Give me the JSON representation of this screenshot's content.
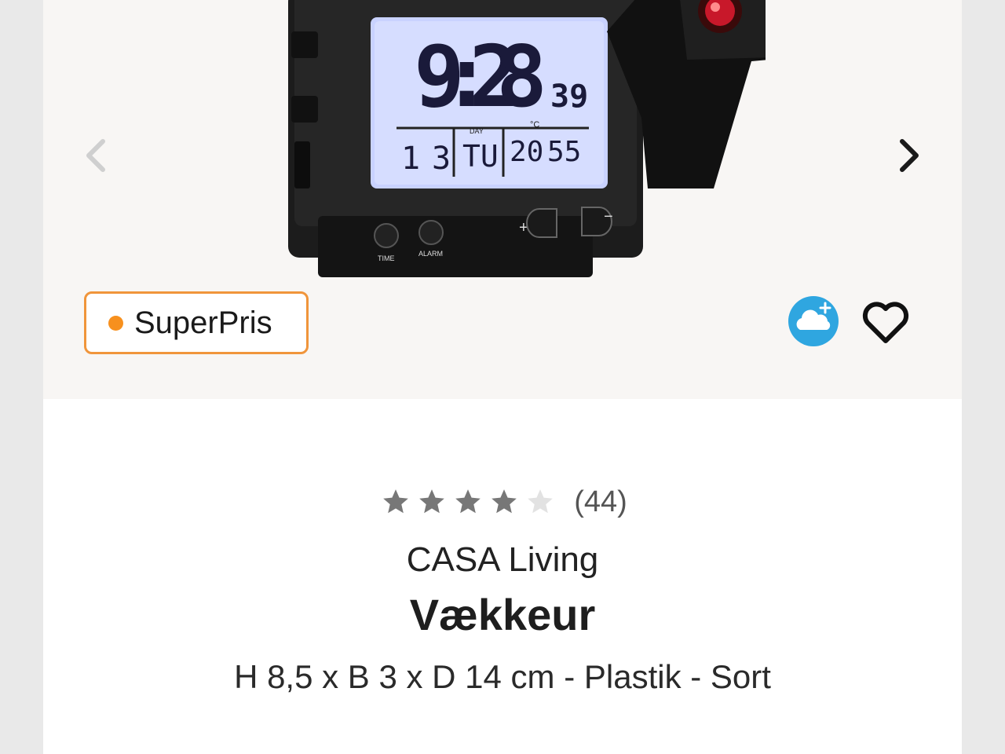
{
  "hero": {
    "badge_label": "SuperPris"
  },
  "product": {
    "rating": 4,
    "rating_max": 5,
    "review_count": "(44)",
    "brand": "CASA Living",
    "title": "Vækkeur",
    "description": "H 8,5 x B 3 x D 14 cm - Plastik - Sort"
  },
  "clock_display": {
    "time": "9:28",
    "seconds": "39",
    "date_day": "1",
    "date_month": "3",
    "weekday_label": "DAY",
    "weekday": "TU",
    "temperature": "20",
    "humidity": "55",
    "unit_label": "°C",
    "time_button": "TIME",
    "alarm_button": "ALARM",
    "plus": "+",
    "minus": "−"
  },
  "colors": {
    "badge_border": "#f0953b",
    "badge_dot": "#f7901e",
    "cloud": "#2fa6e0",
    "screen": "#c9d2ff"
  },
  "icons": {
    "prev": "chevron-left-icon",
    "next": "chevron-right-icon",
    "cloud": "cloud-plus-icon",
    "favorite": "heart-icon",
    "star": "star-icon"
  }
}
